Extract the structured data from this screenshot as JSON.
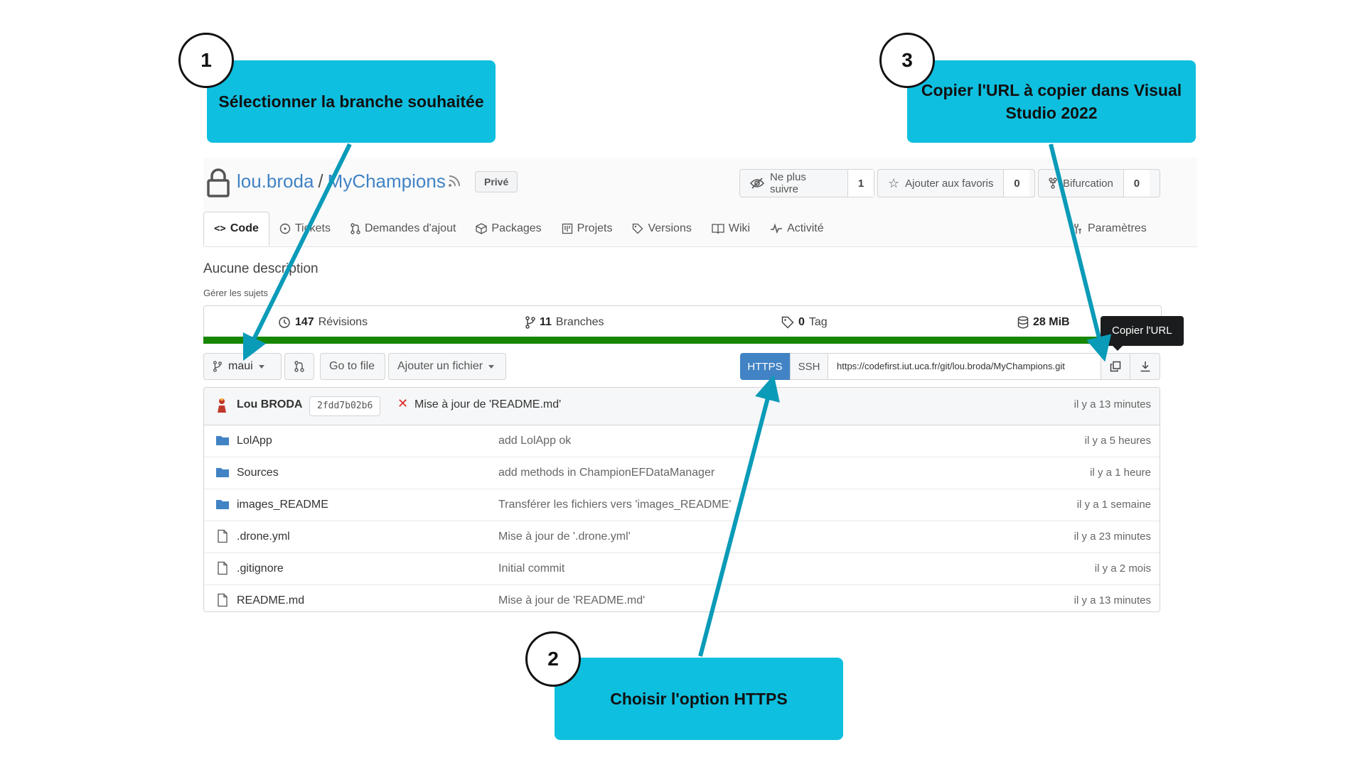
{
  "repo": {
    "owner": "lou.broda",
    "separator": "/",
    "name": "MyChampions",
    "visibility": "Privé",
    "description": "Aucune description",
    "topics_link": "Gérer les sujets"
  },
  "actions": {
    "watch": {
      "label": "Ne plus suivre",
      "count": "1"
    },
    "star": {
      "label": "Ajouter aux favoris",
      "count": "0"
    },
    "fork": {
      "label": "Bifurcation",
      "count": "0"
    }
  },
  "tabs": [
    {
      "label": "Code",
      "icon": "code-icon",
      "active": true
    },
    {
      "label": "Tickets",
      "icon": "issue-icon"
    },
    {
      "label": "Demandes d'ajout",
      "icon": "pull-request-icon"
    },
    {
      "label": "Packages",
      "icon": "package-icon"
    },
    {
      "label": "Projets",
      "icon": "project-icon"
    },
    {
      "label": "Versions",
      "icon": "tag-icon"
    },
    {
      "label": "Wiki",
      "icon": "book-icon"
    },
    {
      "label": "Activité",
      "icon": "pulse-icon"
    }
  ],
  "settings_tab": "Paramètres",
  "stats": {
    "revisions_count": "147",
    "revisions_label": "Révisions",
    "branches_count": "11",
    "branches_label": "Branches",
    "tags_count": "0",
    "tags_label": "Tag",
    "size_value": "28 MiB"
  },
  "toolbar": {
    "branch": "maui",
    "go_to_file": "Go to file",
    "add_file": "Ajouter un fichier",
    "https": "HTTPS",
    "ssh": "SSH",
    "clone_url": "https://codefirst.iut.uca.fr/git/lou.broda/MyChampions.git",
    "copy_tooltip": "Copier l'URL"
  },
  "latest_commit": {
    "author": "Lou BRODA",
    "sha": "2fdd7b02b6",
    "message": "Mise à jour de 'README.md'",
    "time": "il y a 13 minutes"
  },
  "files": [
    {
      "name": "LolApp",
      "type": "folder",
      "message": "add LolApp ok",
      "time": "il y a 5 heures"
    },
    {
      "name": "Sources",
      "type": "folder",
      "message": "add methods in ChampionEFDataManager",
      "time": "il y a 1 heure"
    },
    {
      "name": "images_README",
      "type": "folder",
      "message": "Transférer les fichiers vers 'images_README'",
      "time": "il y a 1 semaine"
    },
    {
      "name": ".drone.yml",
      "type": "file",
      "message": "Mise à jour de '.drone.yml'",
      "time": "il y a 23 minutes"
    },
    {
      "name": ".gitignore",
      "type": "file",
      "message": "Initial commit",
      "time": "il y a 2 mois"
    },
    {
      "name": "README.md",
      "type": "file",
      "message": "Mise à jour de 'README.md'",
      "time": "il y a 13 minutes"
    }
  ],
  "callouts": [
    {
      "number": "1",
      "text": "Sélectionner la branche souhaitée"
    },
    {
      "number": "2",
      "text": "Choisir l'option HTTPS"
    },
    {
      "number": "3",
      "text": "Copier l'URL à copier dans Visual Studio 2022"
    }
  ],
  "colors": {
    "callout": "#0fbfdf",
    "arrow": "#0a9bb8",
    "link": "#4183c4",
    "language_bar": "#178600",
    "folder": "#4183c4"
  }
}
